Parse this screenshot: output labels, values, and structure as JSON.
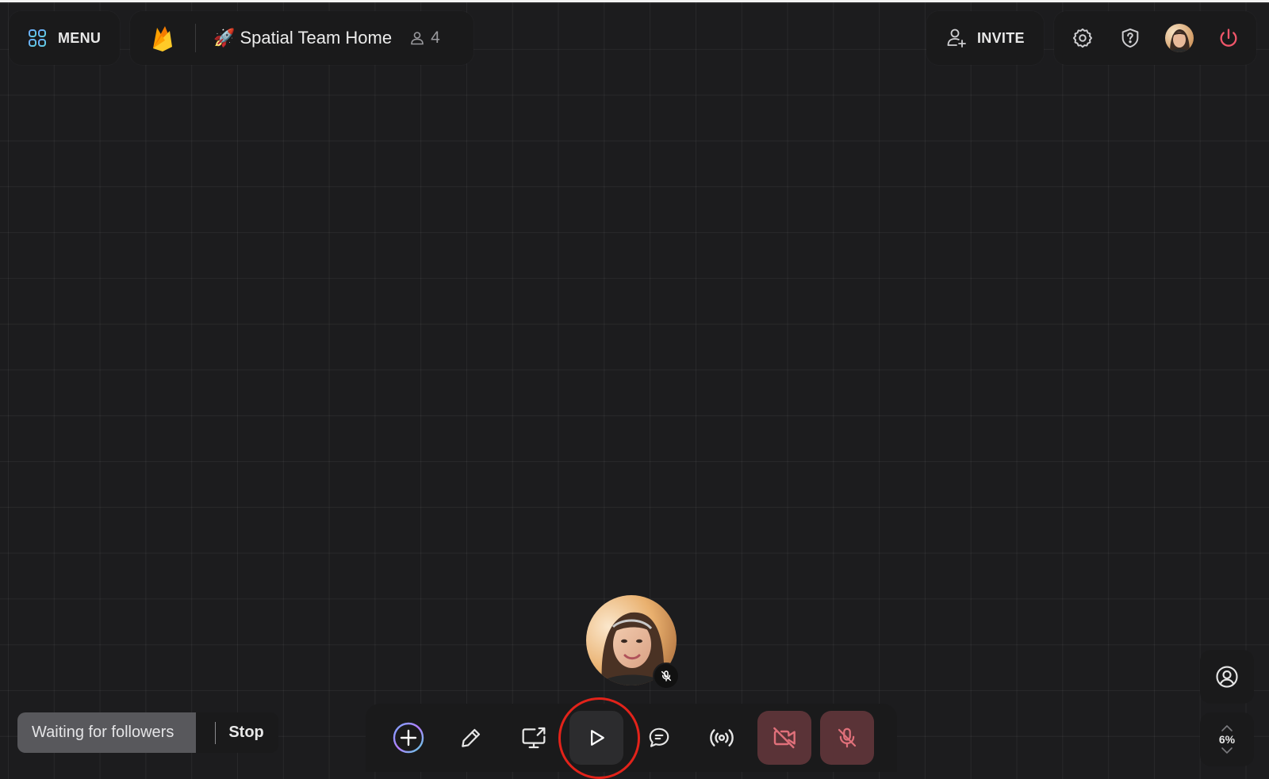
{
  "header": {
    "menu_label": "MENU",
    "space_title": "🚀 Spatial Team Home",
    "member_count": "4",
    "invite_label": "INVITE"
  },
  "follow_status": {
    "waiting_text": "Waiting for followers",
    "stop_label": "Stop"
  },
  "zoom": {
    "level": "6%"
  },
  "toolbar": {
    "tools": [
      "plus-icon",
      "pencil-icon",
      "screen-share-icon",
      "play-icon",
      "chat-icon",
      "broadcast-icon",
      "camera-off-icon",
      "mic-off-icon"
    ],
    "highlighted_tool": "play-icon"
  },
  "colors": {
    "background": "#1c1c1e",
    "panel": "#1a1a1b",
    "danger_button": "#5a3337",
    "danger_icon": "#e0707a",
    "power_icon": "#f0566a",
    "highlight_ring": "#e2231a",
    "waiting_bg": "#58585c"
  }
}
